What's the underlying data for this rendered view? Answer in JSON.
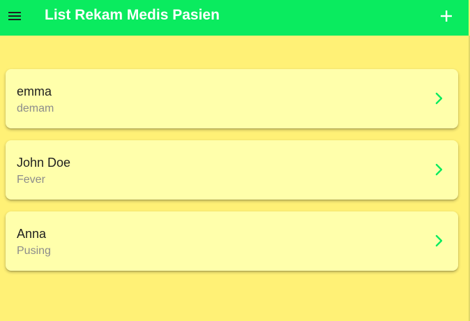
{
  "app_bar": {
    "title": "List Rekam Medis Pasien",
    "menu_icon": "menu-icon",
    "add_icon": "plus-icon",
    "background": "#0aeb5f"
  },
  "page": {
    "background": "#fff176",
    "card_background": "#ffffab",
    "accent": "#0aeb5f"
  },
  "patients": [
    {
      "name": "emma",
      "condition": "demam"
    },
    {
      "name": "John Doe",
      "condition": "Fever"
    },
    {
      "name": "Anna",
      "condition": "Pusing"
    }
  ]
}
